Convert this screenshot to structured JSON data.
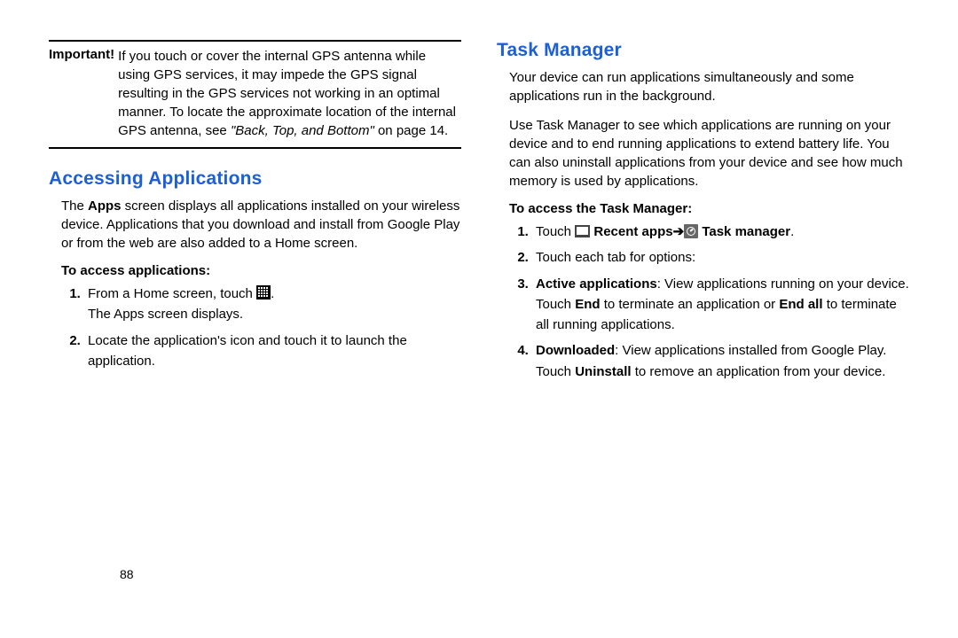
{
  "note": {
    "label": "Important!",
    "text_before_ital": "If you touch or cover the internal GPS antenna while using GPS services, it may impede the GPS signal resulting in the GPS services not working in an optimal manner. To locate the approximate location of the internal GPS antenna, see ",
    "ital": "\"Back, Top, and Bottom\"",
    "text_after_ital": " on page 14."
  },
  "left": {
    "heading": "Accessing Applications",
    "para_prefix": "The ",
    "para_bold": "Apps",
    "para_suffix": " screen displays all applications installed on your wireless device. Applications that you download and install from Google Play or from the web are also added to a Home screen.",
    "subhead": "To access applications:",
    "step1_a": "From a Home screen, touch ",
    "step1_b": ".",
    "step1_line2": "The Apps screen displays.",
    "step2": "Locate the application's icon and touch it to launch the application."
  },
  "right": {
    "heading": "Task Manager",
    "para1": "Your device can run applications simultaneously and some applications run in the background.",
    "para2": "Use Task Manager to see which applications are running on your device and to end running applications to extend battery life. You can also uninstall applications from your device and see how much memory is used by applications.",
    "subhead": "To access the Task Manager:",
    "s1_a": "Touch ",
    "s1_b": "Recent apps",
    "s1_arrow": " ➔ ",
    "s1_c": "Task manager",
    "s1_d": ".",
    "s2": "Touch each tab for options:",
    "s3_bold": "Active applications",
    "s3_a": ": View applications running on your device. Touch ",
    "s3_b": "End",
    "s3_c": " to terminate an application or ",
    "s3_d": "End all",
    "s3_e": " to terminate all running applications.",
    "s4_bold": "Downloaded",
    "s4_a": ": View applications installed from Google Play. Touch ",
    "s4_b": "Uninstall",
    "s4_c": " to remove an application from your device."
  },
  "page_number": "88"
}
